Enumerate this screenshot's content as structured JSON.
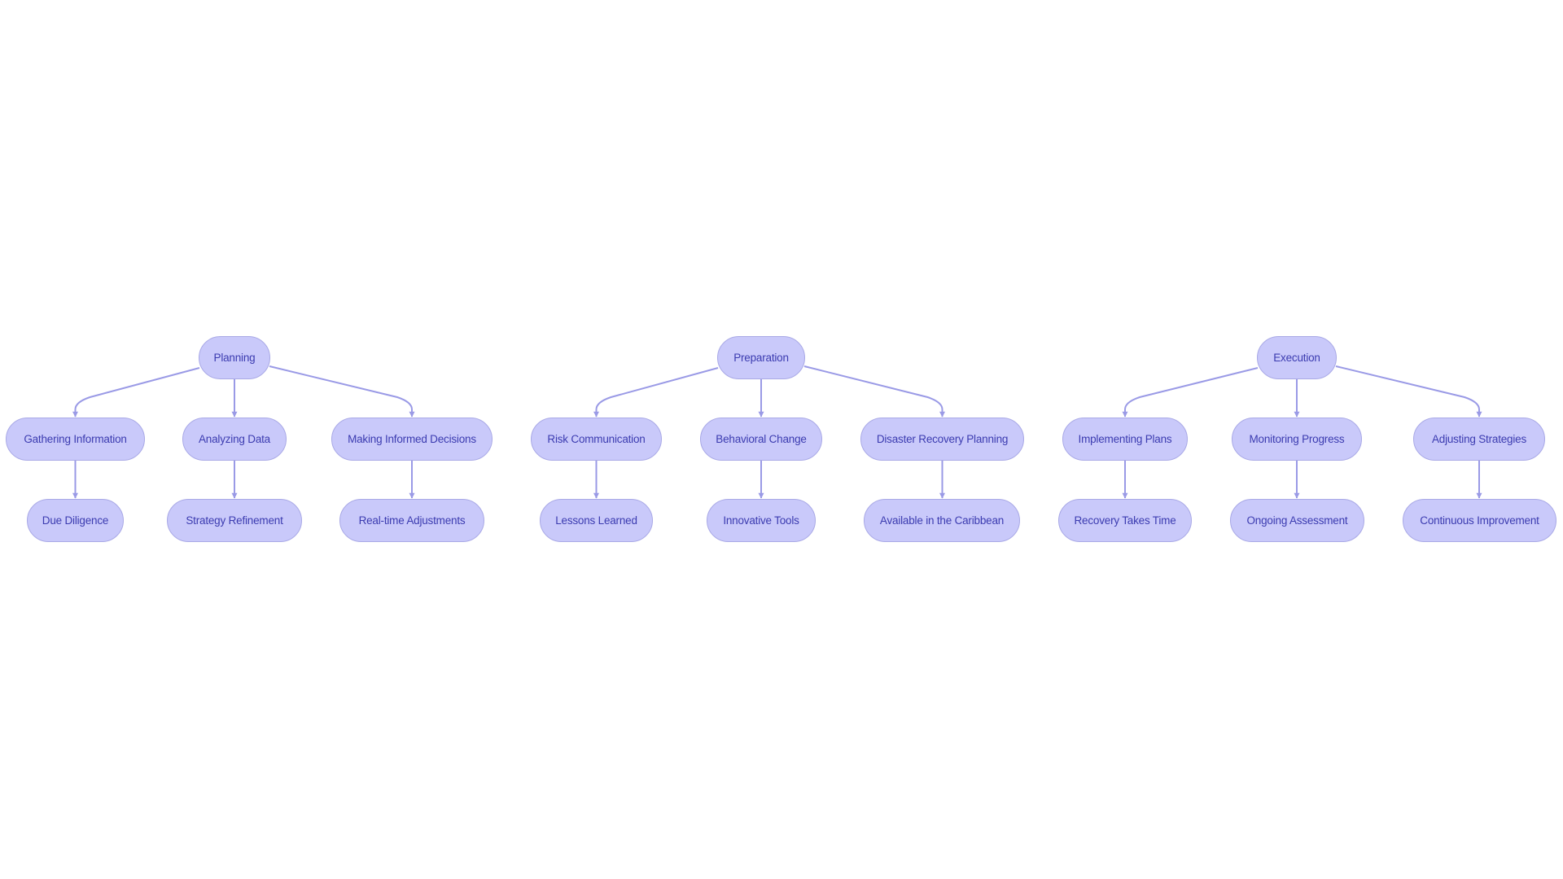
{
  "diagram": {
    "type": "flowchart",
    "direction": "top-down",
    "colors": {
      "node_fill": "#c9c9fa",
      "node_border": "#a9a9e6",
      "node_text": "#3b3bb0",
      "edge": "#9a9ae6",
      "background": "#ffffff"
    },
    "trees": [
      {
        "root": "Planning",
        "children": [
          {
            "label": "Gathering Information",
            "child": "Due Diligence"
          },
          {
            "label": "Analyzing Data",
            "child": "Strategy Refinement"
          },
          {
            "label": "Making Informed Decisions",
            "child": "Real-time Adjustments"
          }
        ]
      },
      {
        "root": "Preparation",
        "children": [
          {
            "label": "Risk Communication",
            "child": "Lessons Learned"
          },
          {
            "label": "Behavioral Change",
            "child": "Innovative Tools"
          },
          {
            "label": "Disaster Recovery Planning",
            "child": "Available in the Caribbean"
          }
        ]
      },
      {
        "root": "Execution",
        "children": [
          {
            "label": "Implementing Plans",
            "child": "Recovery Takes Time"
          },
          {
            "label": "Monitoring Progress",
            "child": "Ongoing Assessment"
          },
          {
            "label": "Adjusting Strategies",
            "child": "Continuous Improvement"
          }
        ]
      }
    ]
  }
}
